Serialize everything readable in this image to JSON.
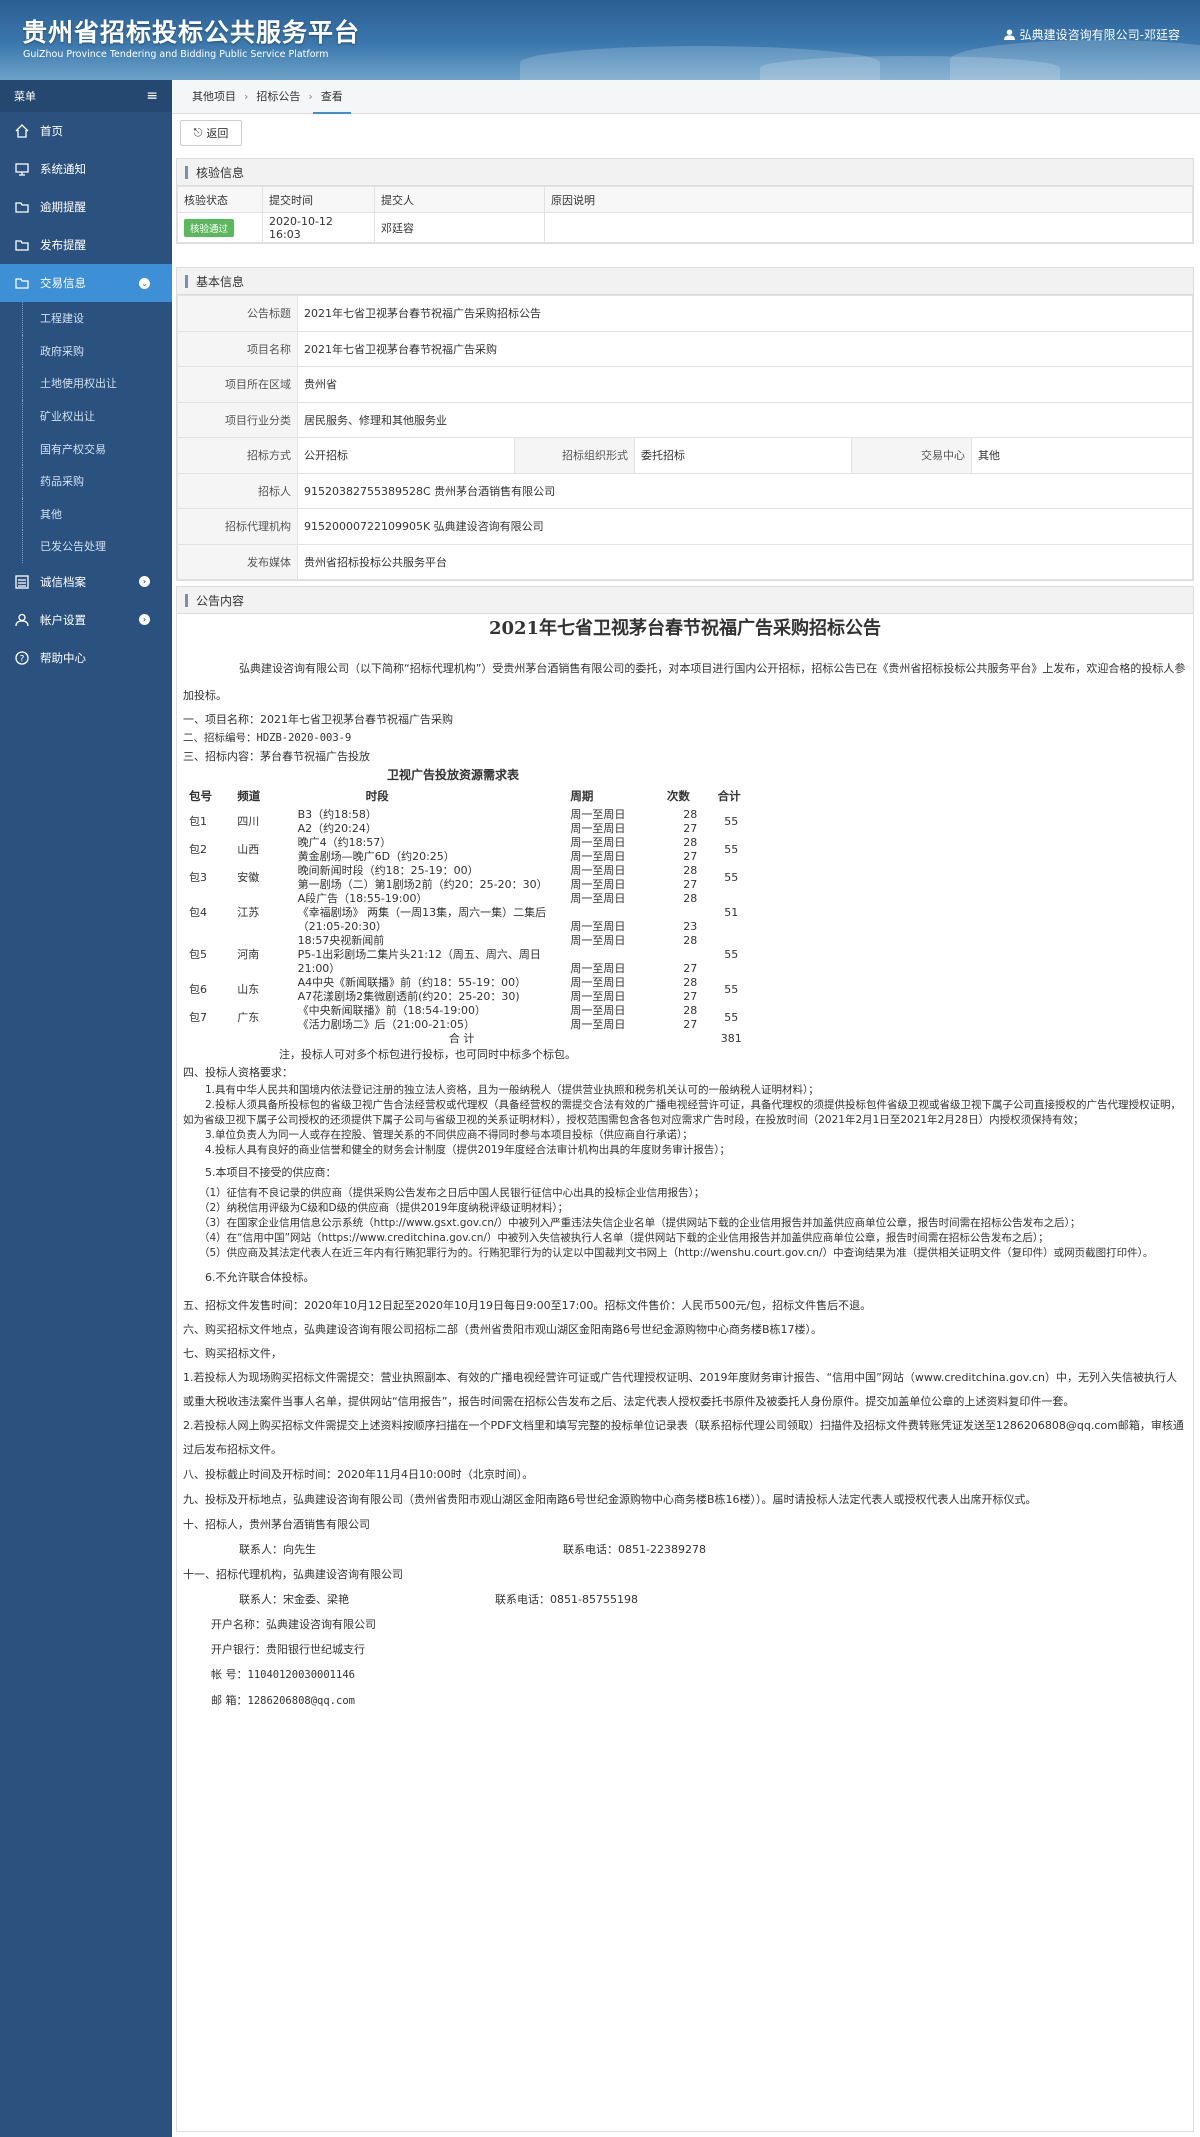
{
  "header": {
    "title": "贵州省招标投标公共服务平台",
    "subtitle": "GuiZhou Province Tendering and Bidding Public Service Platform",
    "user": "弘典建设咨询有限公司-邓廷容"
  },
  "sidebar": {
    "menu_label": "菜单",
    "items": [
      {
        "label": "首页",
        "icon": "home-icon"
      },
      {
        "label": "系统通知",
        "icon": "monitor-icon"
      },
      {
        "label": "逾期提醒",
        "icon": "folder-icon"
      },
      {
        "label": "发布提醒",
        "icon": "folder-icon"
      },
      {
        "label": "交易信息",
        "icon": "folder-icon"
      }
    ],
    "subitems": [
      "工程建设",
      "政府采购",
      "土地使用权出让",
      "矿业权出让",
      "国有产权交易",
      "药品采购",
      "其他",
      "已发公告处理"
    ],
    "bottom": [
      {
        "label": "诚信档案",
        "icon": "list-icon"
      },
      {
        "label": "帐户设置",
        "icon": "user-icon"
      },
      {
        "label": "帮助中心",
        "icon": "help-icon"
      }
    ]
  },
  "breadcrumb": [
    "其他项目",
    "招标公告",
    "查看"
  ],
  "back_label": "返回",
  "verify": {
    "title": "核验信息",
    "headers": [
      "核验状态",
      "提交时间",
      "提交人",
      "原因说明"
    ],
    "status": "核验通过",
    "time": "2020-10-12 16:03",
    "person": "邓廷容",
    "reason": ""
  },
  "basic": {
    "title": "基本信息",
    "announce_title_k": "公告标题",
    "announce_title": "2021年七省卫视茅台春节祝福广告采购招标公告",
    "project_k": "项目名称",
    "project": "2021年七省卫视茅台春节祝福广告采购",
    "region_k": "项目所在区域",
    "region": "贵州省",
    "industry_k": "项目行业分类",
    "industry": "居民服务、修理和其他服务业",
    "method_k": "招标方式",
    "method": "公开招标",
    "org_k": "招标组织形式",
    "org": "委托招标",
    "center_k": "交易中心",
    "center": "其他",
    "tenderer_k": "招标人",
    "tenderer": "91520382755389528C 贵州茅台酒销售有限公司",
    "agent_k": "招标代理机构",
    "agent": "91520000722109905K 弘典建设咨询有限公司",
    "media_k": "发布媒体",
    "media": "贵州省招标投标公共服务平台"
  },
  "content": {
    "title": "公告内容",
    "doc_title": "2021年七省卫视茅台春节祝福广告采购招标公告",
    "intro": "弘典建设咨询有限公司（以下简称“招标代理机构”）受贵州茅台酒销售有限公司的委托，对本项目进行国内公开招标，招标公告已在《贵州省招标投标公共服务平台》上发布，欢迎合格的投标人参加投标。",
    "s1": "一、项目名称：2021年七省卫视茅台春节祝福广告采购",
    "s2": "二、招标编号：HDZB-2020-003-9",
    "s3": "三、招标内容：茅台春节祝福广告投放",
    "table_title": "卫视广告投放资源需求表",
    "table_headers": [
      "包号",
      "频道",
      "时段",
      "周期",
      "次数",
      "合计"
    ],
    "rows": [
      {
        "pkg": "包1",
        "ch": "四川",
        "slots": [
          "B3（约18:58）",
          "A2（约20:24）"
        ],
        "period": [
          "周一至周日",
          "周一至周日"
        ],
        "times": [
          "28",
          "27"
        ],
        "total": "55"
      },
      {
        "pkg": "包2",
        "ch": "山西",
        "slots": [
          "晚广4（约18:57）",
          "黄金剧场—晚广6D（约20:25）"
        ],
        "period": [
          "周一至周日",
          "周一至周日"
        ],
        "times": [
          "28",
          "27"
        ],
        "total": "55"
      },
      {
        "pkg": "包3",
        "ch": "安徽",
        "slots": [
          "晚间新闻时段（约18：25-19：00）",
          "第一剧场（二）第1剧场2前（约20：25-20：30）"
        ],
        "period": [
          "周一至周日",
          "周一至周日"
        ],
        "times": [
          "28",
          "27"
        ],
        "total": "55"
      },
      {
        "pkg": "包4",
        "ch": "江苏",
        "slots": [
          "A段广告（18:55-19:00）",
          "《幸福剧场》 两集（一周13集，周六一集）二集后（21:05-20:30）"
        ],
        "period": [
          "周一至周日",
          "周一至周日"
        ],
        "times": [
          "28",
          "23"
        ],
        "total": "51"
      },
      {
        "pkg": "包5",
        "ch": "河南",
        "slots": [
          "18:57央视新闻前",
          "P5-1出彩剧场二集片头21:12（周五、周六、周日21:00）"
        ],
        "period": [
          "周一至周日",
          "周一至周日"
        ],
        "times": [
          "28",
          "27"
        ],
        "total": "55"
      },
      {
        "pkg": "包6",
        "ch": "山东",
        "slots": [
          "A4中央《新闻联播》前（约18：55-19：00）",
          "A7花漾剧场2集微剧透前(约20：25-20：30)"
        ],
        "period": [
          "周一至周日",
          "周一至周日"
        ],
        "times": [
          "28",
          "27"
        ],
        "total": "55"
      },
      {
        "pkg": "包7",
        "ch": "广东",
        "slots": [
          "《中央新闻联播》前（18:54-19:00）",
          "《活力剧场二》后（21:00-21:05）"
        ],
        "period": [
          "周一至周日",
          "周一至周日"
        ],
        "times": [
          "28",
          "27"
        ],
        "total": "55"
      }
    ],
    "sum_label": "合  计",
    "sum_value": "381",
    "note": "注，投标人可对多个标包进行投标，也可同时中标多个标包。",
    "s4": "四、投标人资格要求：",
    "q1": "1.具有中华人民共和国境内依法登记注册的独立法人资格，且为一般纳税人（提供营业执照和税务机关认可的一般纳税人证明材料）；",
    "q2": "2.投标人须具备所投标包的省级卫视广告合法经营权或代理权（具备经营权的需提交合法有效的广播电视经营许可证，具备代理权的须提供投标包件省级卫视或省级卫视下属子公司直接授权的广告代理授权证明，如为省级卫视下属子公司授权的还须提供下属子公司与省级卫视的关系证明材料），授权范围需包含各包对应需求广告时段，在投放时间（2021年2月1日至2021年2月28日）内授权须保持有效；",
    "q3": "3.单位负责人为同一人或存在控股、管理关系的不同供应商不得同时参与本项目投标（供应商自行承诺）；",
    "q4": "4.投标人具有良好的商业信誉和健全的财务会计制度（提供2019年度经合法审计机构出具的年度财务审计报告）；",
    "q5": "5.本项目不接受的供应商：",
    "r1": "（1）征信有不良记录的供应商（提供采购公告发布之日后中国人民银行征信中心出具的投标企业信用报告）；",
    "r2": "（2）纳税信用评级为C级和D级的供应商（提供2019年度纳税评级证明材料）；",
    "r3": "（3）在国家企业信用信息公示系统（http://www.gsxt.gov.cn/）中被列入严重违法失信企业名单（提供网站下载的企业信用报告并加盖供应商单位公章，报告时间需在招标公告发布之后）；",
    "r4": "（4）在“信用中国”网站（https://www.creditchina.gov.cn/）中被列入失信被执行人名单（提供网站下载的企业信用报告并加盖供应商单位公章，报告时间需在招标公告发布之后）；",
    "r5": "（5）供应商及其法定代表人在近三年内有行贿犯罪行为的。行贿犯罪行为的认定以中国裁判文书网上（http://wenshu.court.gov.cn/）中查询结果为准（提供相关证明文件（复印件）或网页截图打印件）。",
    "q6": "6.不允许联合体投标。",
    "s5": "五、招标文件发售时间：2020年10月12日起至2020年10月19日每日9:00至17:00。招标文件售价：人民币500元/包，招标文件售后不退。",
    "s6": "六、购买招标文件地点，弘典建设咨询有限公司招标二部（贵州省贵阳市观山湖区金阳南路6号世纪金源购物中心商务楼B栋17楼）。",
    "s7": "七、购买招标文件，",
    "b1": "1.若投标人为现场购买招标文件需提交：营业执照副本、有效的广播电视经营许可证或广告代理授权证明、2019年度财务审计报告、“信用中国”网站（www.creditchina.gov.cn）中，无列入失信被执行人或重大税收违法案件当事人名单，提供网站“信用报告”，报告时间需在招标公告发布之后、法定代表人授权委托书原件及被委托人身份原件。提交加盖单位公章的上述资料复印件一套。",
    "b2": "2.若投标人网上购买招标文件需提交上述资料按顺序扫描在一个PDF文档里和填写完整的投标单位记录表（联系招标代理公司领取）扫描件及招标文件费转账凭证发送至1286206808@qq.com邮箱，审核通过后发布招标文件。",
    "s8": "八、投标截止时间及开标时间：2020年11月4日10:00时（北京时间）。",
    "s9": "九、投标及开标地点，弘典建设咨询有限公司（贵州省贵阳市观山湖区金阳南路6号世纪金源购物中心商务楼B栋16楼））。届时请投标人法定代表人或授权代表人出席开标仪式。",
    "s10": "十、招标人，贵州茅台酒销售有限公司",
    "c1a": "联系人：向先生",
    "c1b": "联系电话：0851-22389278",
    "s11": "十一、招标代理机构，弘典建设咨询有限公司",
    "c2a": "联系人：宋金委、梁艳",
    "c2b": "联系电话：0851-85755198",
    "bank1": "开户名称：弘典建设咨询有限公司",
    "bank2": "开户银行：贵阳银行世纪城支行",
    "acct_k": "帐      号：",
    "acct": "11040120030001146",
    "mail_k": "邮      箱：",
    "mail": "1286206808@qq.com"
  }
}
